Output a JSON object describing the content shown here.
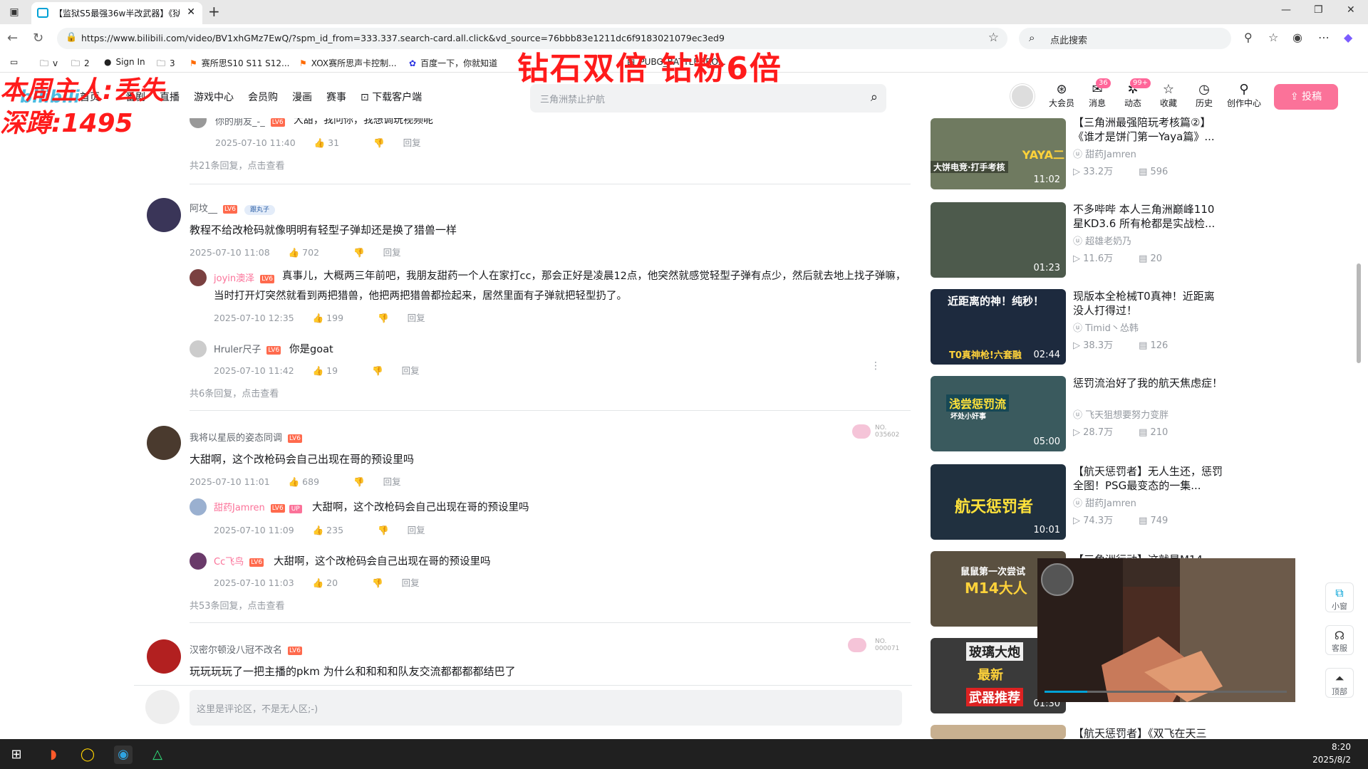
{
  "browser": {
    "tab_title": "【监狱S5最强36w半改武器】《狱",
    "url": "https://www.bilibili.com/video/BV1xhGMz7EwQ/?spm_id_from=333.337.search-card.all.click&vd_source=76bbb83e1211dc6f9183021079ec3ed9",
    "search_placeholder": "点此搜索",
    "bookmarks": [
      "v",
      "2",
      "Sign In",
      "3",
      "赛所思S10 S11 S12...",
      "XOX赛所思声卡控制...",
      "百度一下，你就知道",
      "PUBG_BATTLEGRO..."
    ]
  },
  "overlays": {
    "top_text": "钻石双倍 钻粉6倍",
    "left_line1": "本周主人:丢失",
    "left_line2": "深蹲:1495"
  },
  "site_header": {
    "nav": [
      "首页",
      "番剧",
      "直播",
      "游戏中心",
      "会员购",
      "漫画",
      "赛事",
      "下载客户端"
    ],
    "search_placeholder": "三角洲禁止护航",
    "icons": [
      {
        "label": "大会员",
        "badge": ""
      },
      {
        "label": "消息",
        "badge": "36"
      },
      {
        "label": "动态",
        "badge": "99+"
      },
      {
        "label": "收藏",
        "badge": ""
      },
      {
        "label": "历史",
        "badge": ""
      },
      {
        "label": "创作中心",
        "badge": ""
      }
    ],
    "upload_label": "投稿"
  },
  "comments": {
    "top_partial": {
      "name": "你的朋友_-_",
      "text": "大甜，我问你，我想调玩视频呢",
      "date": "2025-07-10 11:40",
      "likes": "31",
      "reply_label": "回复",
      "more": "共21条回复，点击查看"
    },
    "c1": {
      "name": "阿坟__",
      "fan_badge": "跟丸子",
      "text": "教程不给改枪码就像明明有轻型子弹却还是换了猎兽一样",
      "date": "2025-07-10 11:08",
      "likes": "702",
      "reply_label": "回复",
      "replies": [
        {
          "name": "joyin澳泽",
          "text": "真事儿，大概两三年前吧，我朋友甜药一个人在家打cc，那会正好是凌晨12点，他突然就感觉轻型子弹有点少，然后就去地上找子弹嘛，当时打开灯突然就看到两把猎兽，他把两把猎兽都捡起来，居然里面有子弹就把轻型扔了。",
          "date": "2025-07-10 12:35",
          "likes": "199",
          "reply_label": "回复"
        },
        {
          "name": "Hruler尺子",
          "text": "你是goat",
          "date": "2025-07-10 11:42",
          "likes": "19",
          "reply_label": "回复"
        }
      ],
      "more": "共6条回复，点击查看"
    },
    "c2": {
      "name": "我将以星辰的姿态同调",
      "badge_text": "NO.\n035602",
      "text": "大甜啊，这个改枪码会自己出现在哥的预设里吗",
      "date": "2025-07-10 11:01",
      "likes": "689",
      "reply_label": "回复",
      "replies": [
        {
          "name": "甜药Jamren",
          "up": "UP",
          "text": "大甜啊，这个改枪码会自己出现在哥的预设里吗",
          "date": "2025-07-10 11:09",
          "likes": "235",
          "reply_label": "回复"
        },
        {
          "name": "Cc飞鸟",
          "text": "大甜啊，这个改枪码会自己出现在哥的预设里吗",
          "date": "2025-07-10 11:03",
          "likes": "20",
          "reply_label": "回复"
        }
      ],
      "more": "共53条回复，点击查看"
    },
    "c3": {
      "name": "汉密尔顿没八冠不改名",
      "badge_text": "NO.\n000071",
      "text": "玩玩玩玩了一把主播的pkm 为什么和和和和队友交流都都都都结巴了"
    },
    "input_placeholder": "这里是评论区，不是无人区;-)"
  },
  "level_badge": "LV6",
  "related_videos": [
    {
      "title": "【三角洲最强陪玩考核篇②】《谁才是饼门第一Yaya篇》...",
      "up": "甜药Jamren",
      "views": "33.2万",
      "danmaku": "596",
      "duration": "11:02",
      "thumb_caption": "YAYA二",
      "thumb_caption2": "大饼电竞·打手考核"
    },
    {
      "title": "不多哔哔 本人三角洲巅峰110星KD3.6 所有枪都是实战检...",
      "up": "超雄老奶乃",
      "views": "11.6万",
      "danmaku": "20",
      "duration": "01:23",
      "thumb_caption": "",
      "thumb_caption2": ""
    },
    {
      "title": "现版本全枪械T0真神！近距离没人打得过！",
      "up": "Timid丶怂韩",
      "views": "38.3万",
      "danmaku": "126",
      "duration": "02:44",
      "thumb_caption": "近距离的神！纯秒！",
      "thumb_caption2": "T0真神枪!六套融"
    },
    {
      "title": "惩罚流治好了我的航天焦虑症！",
      "up": "飞天狙想要努力变胖",
      "views": "28.7万",
      "danmaku": "210",
      "duration": "05:00",
      "thumb_caption": "浅尝惩罚流",
      "thumb_caption2": "坏处小奸事"
    },
    {
      "title": "【航天惩罚者】无人生还，惩罚全图！PSG最变态的一集...",
      "up": "甜药Jamren",
      "views": "74.3万",
      "danmaku": "749",
      "duration": "10:01",
      "thumb_caption": "航天惩罚者",
      "thumb_caption2": ""
    },
    {
      "title": "【三角洲行动】这就是M14大...",
      "up": "",
      "views": "",
      "danmaku": "",
      "duration": "",
      "thumb_caption": "鼠鼠第一次尝试",
      "thumb_caption2": "M14大人"
    },
    {
      "title": "",
      "up": "",
      "views": "",
      "danmaku": "",
      "duration": "01:30",
      "thumb_caption": "玻璃大炮",
      "thumb_caption2": "最新"
    },
    {
      "title": "【航天惩罚者】《双飞在天三",
      "up": "",
      "views": "",
      "danmaku": "",
      "duration": "",
      "thumb_caption": "",
      "thumb_caption2": ""
    }
  ],
  "thumb_extra": "武器推荐",
  "side_tools": [
    "小窗",
    "客服",
    "顶部"
  ],
  "taskbar": {
    "time": "8:20",
    "date": "2025/8/2"
  },
  "colors": {
    "bili_blue": "#00a1d6",
    "bili_pink": "#fb7299",
    "overlay_red": "#ff1b1b"
  }
}
